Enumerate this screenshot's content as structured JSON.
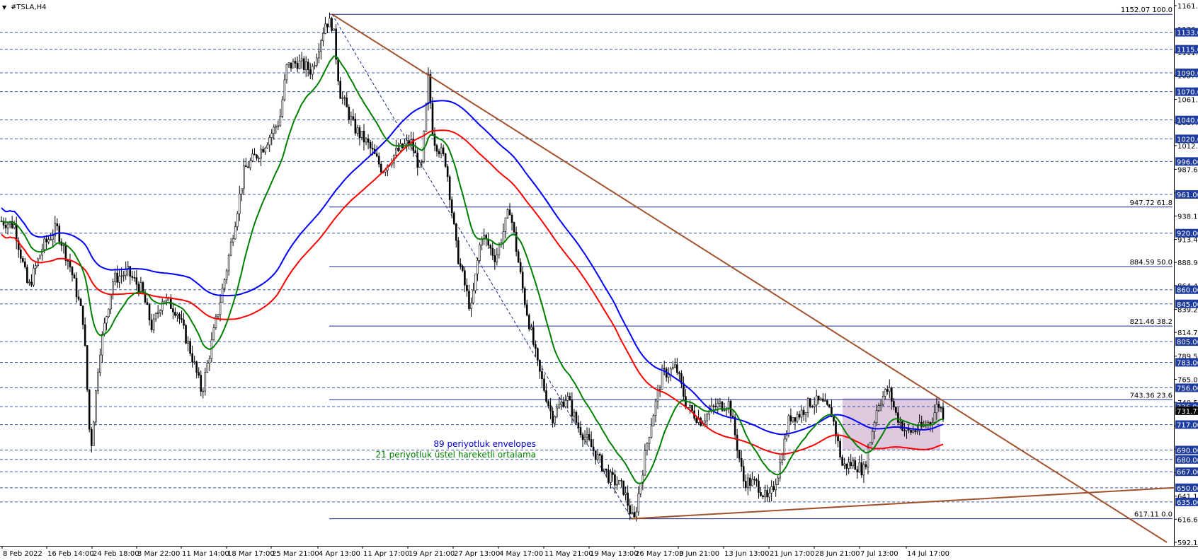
{
  "header": {
    "symbol_label": "#TSLA,H4",
    "menu_glyph": "▼"
  },
  "legend": {
    "line1": "89 periyotluk envelopes",
    "line2": "21 periyotluk üstel hareketli ortalama"
  },
  "chart_data": {
    "type": "candlestick",
    "symbol": "#TSLA",
    "timeframe": "H4",
    "ylim": [
      592.13,
      1161.23
    ],
    "price_axis_ticks": [
      1161.23,
      1136.33,
      1111.83,
      1087.33,
      1061.83,
      1037.33,
      1012.83,
      987.63,
      962.63,
      938.13,
      913.43,
      888.93,
      864.43,
      839.23,
      814.73,
      789.53,
      765.03,
      740.53,
      715.33,
      690.83,
      666.13,
      641.13,
      616.63,
      592.13
    ],
    "time_labels": [
      "8 Feb 2022",
      "16 Feb 14:00",
      "24 Feb 18:00",
      "3 Mar 22:00",
      "11 Mar 14:00",
      "18 Mar 17:00",
      "25 Mar 21:00",
      "4 Apr 13:00",
      "11 Apr 17:00",
      "19 Apr 21:00",
      "27 Apr 13:00",
      "4 May 17:00",
      "11 May 21:00",
      "19 May 13:00",
      "26 May 17:00",
      "3 Jun 21:00",
      "13 Jun 13:00",
      "21 Jun 17:00",
      "28 Jun 21:00",
      "7 Jul 13:00",
      "14 Jul 17:00"
    ],
    "horizontal_levels": [
      1133.0,
      1115.0,
      1090.0,
      1070.0,
      1040.0,
      1020.0,
      996.0,
      961.0,
      920.0,
      860.0,
      845.0,
      805.0,
      783.0,
      756.0,
      736.0,
      717.0,
      690.0,
      680.0,
      667.0,
      650.0,
      635.0
    ],
    "fibonacci_levels": [
      {
        "price": 1152.07,
        "label": "1152.07 100.0"
      },
      {
        "price": 947.72,
        "label": "947.72 61.8"
      },
      {
        "price": 884.59,
        "label": "884.59 50.0"
      },
      {
        "price": 821.46,
        "label": "821.46 38.2"
      },
      {
        "price": 743.36,
        "label": "743.36 23.6"
      },
      {
        "price": 617.11,
        "label": "617.11 0.0"
      }
    ],
    "current_price": 731.71,
    "series": [
      {
        "name": "89 periyotluk envelopes",
        "color": "#0000ff",
        "role": "upper envelope"
      },
      {
        "name": "89 periyotluk envelopes",
        "color": "#ff0000",
        "role": "lower envelope"
      },
      {
        "name": "21 periyotluk üstel hareketli ortalama",
        "color": "#008000"
      }
    ],
    "trendlines": [
      {
        "from": [
          "4 Apr 13:00",
          1152.07
        ],
        "to": [
          "beyond 14 Jul 17:00",
          592.13
        ],
        "color": "#a0522d"
      },
      {
        "from": [
          "19 May 13:00",
          617.11
        ],
        "to": [
          "beyond 14 Jul 17:00",
          650.0
        ],
        "color": "#a0522d"
      }
    ],
    "rectangle": {
      "from": [
        "28 Jun 21:00",
        745.0
      ],
      "to": [
        "14 Jul 17:00",
        690.0
      ],
      "color": "#d8bfd8"
    }
  },
  "colors": {
    "level_line": "#1e3ca0",
    "level_label_bg": "#1e3ca0",
    "candle": "#000000",
    "ema": "#008000",
    "envelope_upper": "#0000ff",
    "envelope_lower": "#ff0000",
    "trendline": "#a0522d",
    "legend_blue": "#0000cd",
    "legend_green": "#008000"
  }
}
